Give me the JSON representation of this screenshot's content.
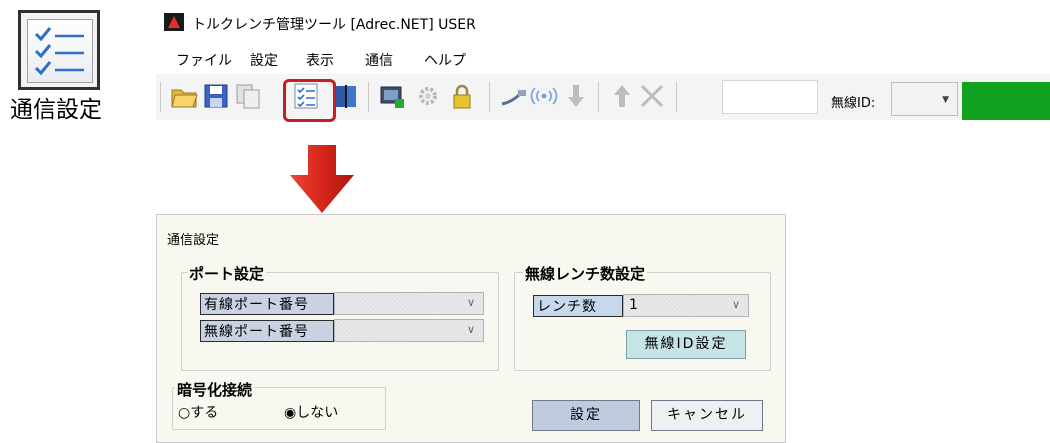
{
  "big_icon": {
    "label": "通信設定",
    "icon": "checklist-icon"
  },
  "window": {
    "title": "トルクレンチ管理ツール [Adrec.NET] USER",
    "menu": [
      "ファイル",
      "設定",
      "表示",
      "通信",
      "ヘルプ"
    ],
    "wireless_id_label": "無線ID:",
    "wireless_id_value": "",
    "status_color": "#12a11f",
    "highlight_color": "#c81d24"
  },
  "toolbar_icons": [
    "open-folder-icon",
    "save-icon",
    "copy-icon",
    "comm-settings-icon",
    "book-icon",
    "screen-export-icon",
    "gear-icon",
    "lock-icon",
    "cable-icon",
    "wireless-icon",
    "arrow-down-icon",
    "arrow-up-icon",
    "delete-icon"
  ],
  "dialog": {
    "title": "通信設定",
    "port_group": {
      "title": "ポート設定",
      "wired_label": "有線ポート番号",
      "wired_value": "",
      "wireless_label": "無線ポート番号",
      "wireless_value": ""
    },
    "wrench_group": {
      "title": "無線レンチ数設定",
      "count_label": "レンチ数",
      "count_value": "1",
      "wireless_id_button": "無線ID設定"
    },
    "encrypt_group": {
      "title": "暗号化接続",
      "option_yes": "する",
      "option_no": "しない",
      "selected": "しない"
    },
    "ok_button": "設定",
    "cancel_button": "キャンセル"
  }
}
